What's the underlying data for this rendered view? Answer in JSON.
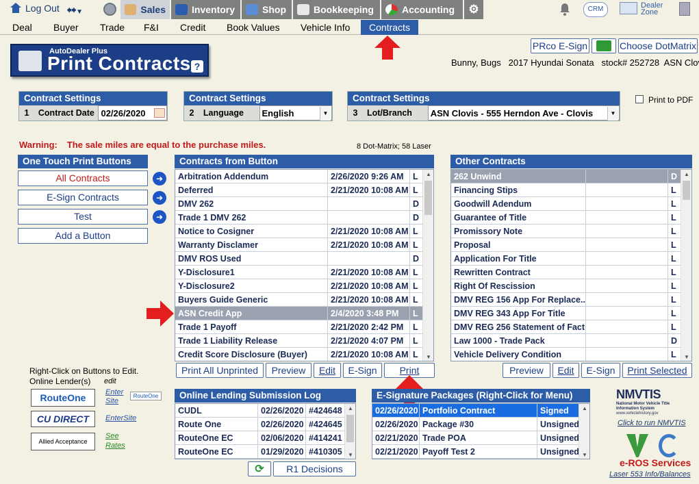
{
  "topbar": {
    "logout": "Log Out",
    "tabs": [
      {
        "label": "Sales",
        "active": true,
        "icon": "salesperson-icon"
      },
      {
        "label": "Inventory",
        "active": false,
        "icon": "car-icon"
      },
      {
        "label": "Shop",
        "active": false,
        "icon": "wrench-icon"
      },
      {
        "label": "Bookkeeping",
        "active": false,
        "icon": "book-icon"
      },
      {
        "label": "Accounting",
        "active": false,
        "icon": "pie-chart-icon"
      }
    ],
    "crm": "CRM",
    "dealer_zone": [
      "Dealer",
      "Zone"
    ]
  },
  "submenu": [
    "Deal",
    "Buyer",
    "Trade",
    "F&I",
    "Credit",
    "Book Values",
    "Vehicle Info",
    "Contracts"
  ],
  "submenu_active": "Contracts",
  "title": {
    "small": "AutoDealer Plus",
    "big": "Print Contracts",
    "help": "?"
  },
  "top_buttons": {
    "esign": "PRco E-Sign",
    "choose": "Choose DotMatrix"
  },
  "customer": {
    "name": "Bunny,  Bugs",
    "vehicle": "2017 Hyundai Sonata",
    "stock": "stock# 252728",
    "location": "ASN Clovis"
  },
  "settings": [
    {
      "header": "Contract Settings",
      "num": "1",
      "label": "Contract Date",
      "value": "02/26/2020"
    },
    {
      "header": "Contract Settings",
      "num": "2",
      "label": "Language",
      "value": "English"
    },
    {
      "header": "Contract Settings",
      "num": "3",
      "label": "Lot/Branch",
      "value": "ASN Clovis - 555 Herndon Ave - Clovis"
    }
  ],
  "print_to_pdf": "Print to PDF",
  "warning": {
    "label": "Warning:",
    "text": "The sale miles are equal to the purchase miles."
  },
  "dot_info": "8 Dot-Matrix; 58 Laser",
  "one_touch": {
    "header": "One Touch Print Buttons",
    "buttons": [
      "All Contracts",
      "E-Sign Contracts",
      "Test",
      "Add a Button"
    ]
  },
  "contracts_from_button": {
    "header": "Contracts from Button",
    "rows": [
      {
        "name": "Arbitration Addendum",
        "date": "2/26/2020 9:26 AM",
        "type": "L"
      },
      {
        "name": "Deferred",
        "date": "2/21/2020 10:08 AM",
        "type": "L"
      },
      {
        "name": "DMV 262",
        "date": "",
        "type": "D"
      },
      {
        "name": "Trade 1 DMV 262",
        "date": "",
        "type": "D"
      },
      {
        "name": "Notice to Cosigner",
        "date": "2/21/2020 10:08 AM",
        "type": "L"
      },
      {
        "name": "Warranty Disclamer",
        "date": "2/21/2020 10:08 AM",
        "type": "L"
      },
      {
        "name": "DMV ROS Used",
        "date": "",
        "type": "D"
      },
      {
        "name": "Y-Disclosure1",
        "date": "2/21/2020 10:08 AM",
        "type": "L"
      },
      {
        "name": "Y-Disclosure2",
        "date": "2/21/2020 10:08 AM",
        "type": "L"
      },
      {
        "name": "Buyers Guide Generic",
        "date": "2/21/2020 10:08 AM",
        "type": "L"
      },
      {
        "name": "ASN Credit App",
        "date": "2/4/2020 3:48 PM",
        "type": "L"
      },
      {
        "name": "Trade 1 Payoff",
        "date": "2/21/2020 2:42 PM",
        "type": "L"
      },
      {
        "name": "Trade 1 Liability Release",
        "date": "2/21/2020 4:07 PM",
        "type": "L"
      },
      {
        "name": "Credit Score Disclosure (Buyer)",
        "date": "2/21/2020 10:08 AM",
        "type": "L"
      }
    ],
    "buttons": [
      "Print All Unprinted",
      "Preview",
      "Edit",
      "E-Sign",
      "Print"
    ]
  },
  "other_contracts": {
    "header": "Other Contracts",
    "rows": [
      {
        "name": "262 Unwind",
        "type": "D"
      },
      {
        "name": "Financing Stips",
        "type": "L"
      },
      {
        "name": "Goodwill Adendum",
        "type": "L"
      },
      {
        "name": "Guarantee of Title",
        "type": "L"
      },
      {
        "name": "Promissory Note",
        "type": "L"
      },
      {
        "name": "Proposal",
        "type": "L"
      },
      {
        "name": "Application For Title",
        "type": "L"
      },
      {
        "name": "Rewritten Contract",
        "type": "L"
      },
      {
        "name": "Right Of Rescission",
        "type": "L"
      },
      {
        "name": "DMV REG 156 App For Replace...",
        "type": "L"
      },
      {
        "name": "DMV REG 343 App For Title",
        "type": "L"
      },
      {
        "name": "DMV REG 256 Statement of Fact",
        "type": "L"
      },
      {
        "name": "Law 1000 - Trade Pack",
        "type": "D"
      },
      {
        "name": "Vehicle Delivery Condition",
        "type": "L"
      }
    ],
    "buttons": [
      "Preview",
      "Edit",
      "E-Sign",
      "Print Selected"
    ]
  },
  "right_click_note": "Right-Click on Buttons to Edit.",
  "online_lenders": {
    "label": "Online Lender(s)",
    "edit": "edit",
    "items": [
      {
        "name": "RouteOne",
        "link1": "Enter",
        "link2": "Site"
      },
      {
        "name": "CU DIRECT",
        "link1": "EnterSite",
        "link2": ""
      },
      {
        "name": "Allied Acceptance",
        "link1": "See",
        "link2": "Rates"
      }
    ]
  },
  "lending_log": {
    "header": "Online Lending Submission Log",
    "rows": [
      {
        "lender": "CUDL",
        "date": "02/26/2020",
        "num": "#424648"
      },
      {
        "lender": "Route One",
        "date": "02/26/2020",
        "num": "#424645"
      },
      {
        "lender": "RouteOne EC",
        "date": "02/06/2020",
        "num": "#414241"
      },
      {
        "lender": "RouteOne EC",
        "date": "01/29/2020",
        "num": "#410305"
      }
    ],
    "r1_button": "R1 Decisions"
  },
  "esign_packages": {
    "header": "E-Signature Packages (Right-Click for Menu)",
    "rows": [
      {
        "date": "02/26/2020",
        "name": "Portfolio Contract",
        "status": "Signed"
      },
      {
        "date": "02/26/2020",
        "name": "Package #30",
        "status": "Unsigned"
      },
      {
        "date": "02/21/2020",
        "name": "Trade POA",
        "status": "Unsigned"
      },
      {
        "date": "02/21/2020",
        "name": "Payoff Test 2",
        "status": "Unsigned"
      }
    ]
  },
  "nmvtis": {
    "logo": "NMVTIS",
    "sub": "National Motor Vehicle Title Information System",
    "site": "www.vehiclehistory.gov",
    "link": "Click to run NMVTIS"
  },
  "eros": {
    "label": "e-ROS Services",
    "link": "Laser 553 Info/Balances"
  }
}
